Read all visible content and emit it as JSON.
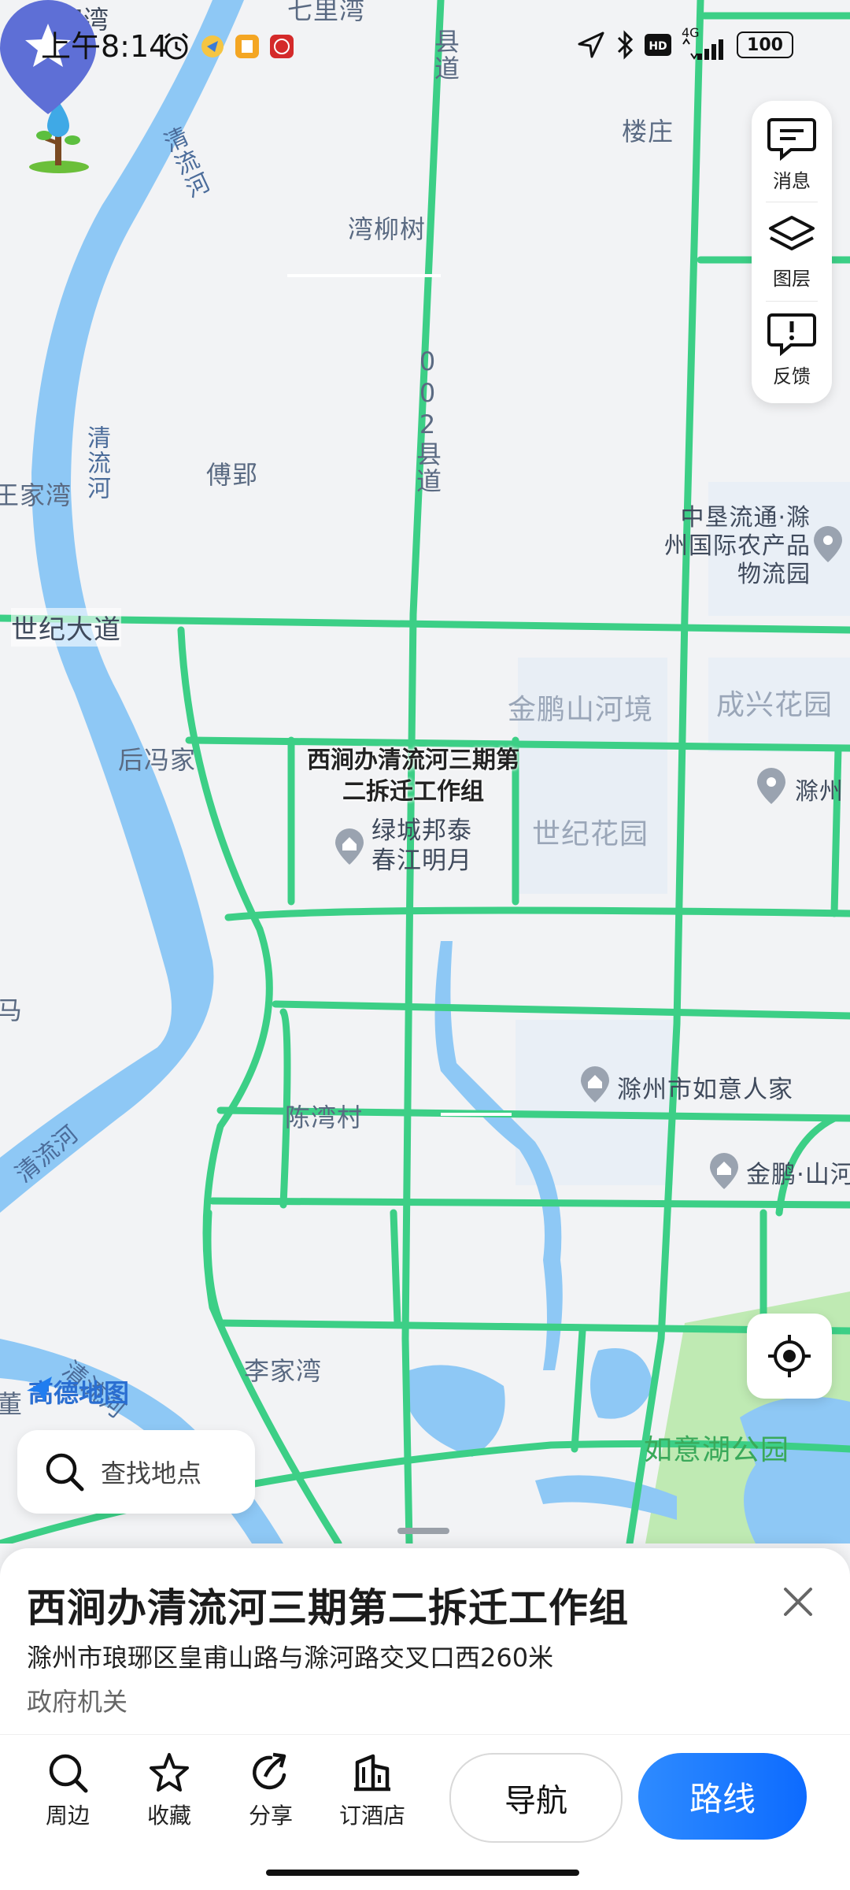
{
  "status_bar": {
    "time": "上午8:14",
    "network": "4G",
    "battery": "100"
  },
  "map": {
    "labels": {
      "guojiawan": "郭家湾",
      "qilixiao": "七里湾",
      "louzhuang": "楼庄",
      "wanliushu": "湾柳树",
      "fuying": "傅郢",
      "jiawan_left": "王家湾",
      "shijidadao": "世纪大道",
      "houfengjia": "后冯家",
      "jinpeng": "金鹏山河境",
      "chengxing": "成兴花园",
      "shiji_huayuan": "世纪花园",
      "chenwancun": "陈湾村",
      "lijiawan": "李家湾",
      "ma": "马",
      "dong": "董"
    },
    "road_labels": {
      "county_road_top": "县道",
      "county_road_mid": "002县道"
    },
    "river_labels": {
      "qingliuhe_1": "清流河",
      "qingliuhe_2": "清流河",
      "qingliuhe_3": "清流河",
      "qingliuhe_4": "清流河"
    },
    "pois": {
      "zhongken": "中垦流通·滁州国际农产品物流园",
      "chuzhou_right": "滁州",
      "lvcheng": "绿城邦泰春江明月",
      "ruyi_renjia": "滁州市如意人家",
      "jinpeng_shan": "金鹏·山河"
    },
    "park_label": "如意湖公园",
    "brand": "高德地图",
    "selected_poi_label": "西涧办清流河三期第二拆迁工作组"
  },
  "right_panel": {
    "messages": "消息",
    "layers": "图层",
    "feedback": "反馈"
  },
  "search": {
    "placeholder": "查找地点"
  },
  "place": {
    "title": "西涧办清流河三期第二拆迁工作组",
    "address": "滁州市琅琊区皇甫山路与滁河路交叉口西260米",
    "category": "政府机关"
  },
  "actions": {
    "nearby": "周边",
    "favorite": "收藏",
    "share": "分享",
    "hotel": "订酒店",
    "navigate": "导航",
    "route": "路线"
  },
  "colors": {
    "road": "#3ccf86",
    "river": "#8ec8f5",
    "park": "#bfeab3",
    "pin": "#5e6fd6",
    "route_button": "#1677ff"
  }
}
